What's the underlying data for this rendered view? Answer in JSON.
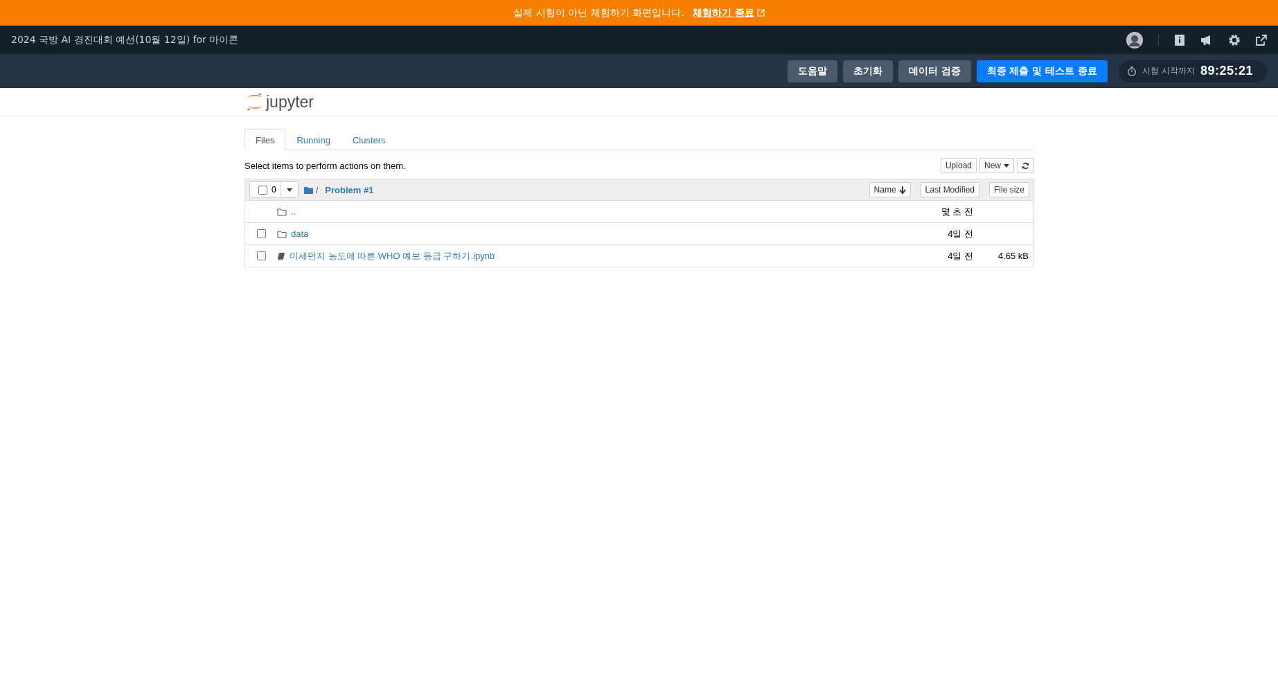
{
  "banner": {
    "message": "실제 시험이 아닌 체험하기 화면입니다.",
    "link": "체험하기 종료"
  },
  "header": {
    "title": "2024 국방 AI 경진대회 예선(10월 12일) for 마이콘"
  },
  "toolbar": {
    "buttons": [
      {
        "label": "도움말",
        "kind": "secondary"
      },
      {
        "label": "초기화",
        "kind": "secondary"
      },
      {
        "label": "데이터 검증",
        "kind": "secondary"
      },
      {
        "label": "최종 제출 및 테스트 종료",
        "kind": "primary"
      }
    ],
    "timer": {
      "label": "시험 시작까지",
      "value": "89:25:21"
    }
  },
  "jupyter": {
    "logo": "jupyter"
  },
  "tabs": [
    {
      "label": "Files",
      "selected": true
    },
    {
      "label": "Running",
      "selected": false
    },
    {
      "label": "Clusters",
      "selected": false
    }
  ],
  "hint": "Select items to perform actions on them.",
  "actions": {
    "upload": "Upload",
    "new": "New"
  },
  "list_header": {
    "count": "0",
    "separator": "/",
    "path": "Problem #1",
    "sort_buttons": [
      "Name",
      "Last Modified",
      "File size"
    ]
  },
  "items": [
    {
      "kind": "parent",
      "name": "..",
      "modified": "몇 초 전"
    },
    {
      "kind": "folder",
      "name": "data",
      "modified": "4일 전",
      "checked": false
    },
    {
      "kind": "notebook",
      "name": "미세먼지 농도에 따른 WHO 예보 등급 구하기.ipynb",
      "modified": "4일 전",
      "size": "4.65 kB",
      "checked": false
    }
  ]
}
